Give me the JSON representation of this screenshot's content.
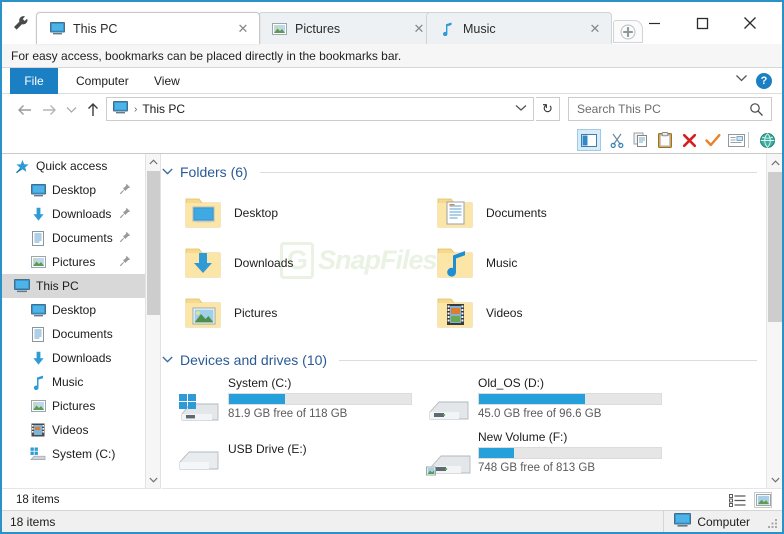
{
  "window": {
    "frame_color": "#2a92c8",
    "controls": {
      "minimize": "—",
      "maximize": "☐",
      "close": "✕"
    },
    "wrench_icon": "wrench-icon"
  },
  "tabs": {
    "items": [
      {
        "label": "This PC",
        "icon": "monitor-icon",
        "active": true,
        "close": "✕"
      },
      {
        "label": "Pictures",
        "icon": "picture-icon",
        "active": false,
        "close": "✕"
      },
      {
        "label": "Music",
        "icon": "music-note-icon",
        "active": false,
        "close": "✕"
      }
    ],
    "new_tab_label": "+"
  },
  "notice": {
    "text": "For easy access, bookmarks can be placed directly in the bookmarks bar."
  },
  "ribbon": {
    "file_label": "File",
    "tabs": [
      {
        "label": "Computer"
      },
      {
        "label": "View"
      }
    ],
    "collapse_icon": "chevron-down-icon",
    "help_icon": "help-icon",
    "help_glyph": "?"
  },
  "address": {
    "back_icon": "arrow-left-icon",
    "forward_icon": "arrow-right-icon",
    "recent_icon": "chevron-down-icon",
    "up_icon": "arrow-up-icon",
    "path_icon": "monitor-icon",
    "separator": "›",
    "path_text": "This PC",
    "dropdown_icon": "chevron-down-icon",
    "refresh_icon": "↻"
  },
  "search": {
    "placeholder": "Search This PC",
    "icon": "search-icon"
  },
  "command_bar": {
    "buttons": [
      {
        "name": "navigation-pane-toggle",
        "icon": "pane-icon",
        "active": true
      },
      {
        "name": "cut",
        "icon": "scissors-icon"
      },
      {
        "name": "copy",
        "icon": "copy-icon"
      },
      {
        "name": "paste",
        "icon": "clipboard-icon"
      },
      {
        "name": "delete",
        "icon": "red-x-icon"
      },
      {
        "name": "confirm",
        "icon": "orange-check-icon"
      },
      {
        "name": "rename",
        "icon": "rename-icon"
      },
      {
        "name": "browse-web",
        "icon": "globe-icon"
      }
    ]
  },
  "sidebar": {
    "items": [
      {
        "label": "Quick access",
        "icon": "star-pin-icon",
        "level": 0,
        "selected": false,
        "pinned": false
      },
      {
        "label": "Desktop",
        "icon": "monitor-icon",
        "level": 1,
        "selected": false,
        "pinned": true
      },
      {
        "label": "Downloads",
        "icon": "download-arrow-icon",
        "level": 1,
        "selected": false,
        "pinned": true
      },
      {
        "label": "Documents",
        "icon": "document-icon",
        "level": 1,
        "selected": false,
        "pinned": true
      },
      {
        "label": "Pictures",
        "icon": "picture-icon",
        "level": 1,
        "selected": false,
        "pinned": true
      },
      {
        "label": "This PC",
        "icon": "monitor-icon",
        "level": 0,
        "selected": true,
        "pinned": false
      },
      {
        "label": "Desktop",
        "icon": "monitor-icon",
        "level": 1,
        "selected": false,
        "pinned": false
      },
      {
        "label": "Documents",
        "icon": "document-icon",
        "level": 1,
        "selected": false,
        "pinned": false
      },
      {
        "label": "Downloads",
        "icon": "download-arrow-icon",
        "level": 1,
        "selected": false,
        "pinned": false
      },
      {
        "label": "Music",
        "icon": "music-note-icon",
        "level": 1,
        "selected": false,
        "pinned": false
      },
      {
        "label": "Pictures",
        "icon": "picture-icon",
        "level": 1,
        "selected": false,
        "pinned": false
      },
      {
        "label": "Videos",
        "icon": "video-icon",
        "level": 1,
        "selected": false,
        "pinned": false
      },
      {
        "label": "System (C:)",
        "icon": "drive-icon",
        "level": 1,
        "selected": false,
        "pinned": false
      }
    ],
    "status_text": "18 items"
  },
  "content": {
    "watermark": "SnapFiles",
    "watermark_mark": "G",
    "groups": [
      {
        "title": "Folders (6)",
        "chevron": "⌄",
        "items": [
          {
            "label": "Desktop",
            "icon": "folder-desktop-icon"
          },
          {
            "label": "Documents",
            "icon": "folder-documents-icon"
          },
          {
            "label": "Downloads",
            "icon": "folder-downloads-icon"
          },
          {
            "label": "Music",
            "icon": "folder-music-icon"
          },
          {
            "label": "Pictures",
            "icon": "folder-pictures-icon"
          },
          {
            "label": "Videos",
            "icon": "folder-videos-icon"
          }
        ]
      },
      {
        "title": "Devices and drives (10)",
        "chevron": "⌄",
        "drives": [
          {
            "name": "System (C:)",
            "icon": "windows-drive-icon",
            "free_text": "81.9 GB free of 118 GB",
            "used_percent": 31,
            "bar_color": "#26a0da",
            "has_bar": true
          },
          {
            "name": "Old_OS (D:)",
            "icon": "external-drive-icon",
            "free_text": "45.0 GB free of 96.6 GB",
            "used_percent": 58,
            "bar_color": "#26a0da",
            "has_bar": true
          },
          {
            "name": "USB Drive (E:)",
            "icon": "usb-drive-icon",
            "free_text": "",
            "used_percent": 0,
            "bar_color": "#26a0da",
            "has_bar": false
          },
          {
            "name": "New Volume (F:)",
            "icon": "external-drive-icon",
            "free_text": "748 GB free of 813 GB",
            "used_percent": 19,
            "bar_color": "#26a0da",
            "has_bar": true
          }
        ]
      }
    ]
  },
  "view_modes": {
    "details_icon": "details-view-icon",
    "icons_icon": "large-icons-view-icon"
  },
  "statusbar": {
    "items_text": "18 items",
    "computer_label": "Computer",
    "computer_icon": "monitor-icon",
    "grip_icon": "resize-grip-icon"
  }
}
